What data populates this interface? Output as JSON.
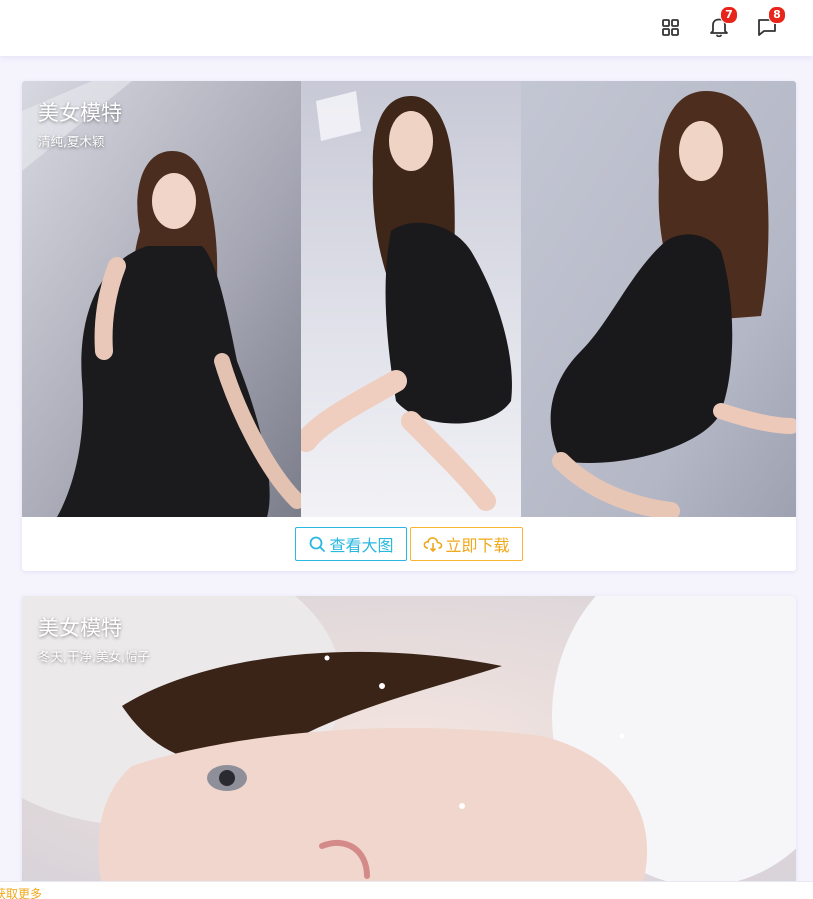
{
  "header": {
    "icons": [
      {
        "name": "grid-apps-icon"
      },
      {
        "name": "bell-icon",
        "badge": "7"
      },
      {
        "name": "message-icon",
        "badge": "8"
      }
    ],
    "badge_color": "#e8251a"
  },
  "cards": [
    {
      "title": "美女模特",
      "tags": "清纯,夏木颖",
      "actions": {
        "view_label": "查看大图",
        "download_label": "立即下载"
      }
    },
    {
      "title": "美女模特",
      "tags": "冬天,干净,美女,帽子"
    }
  ],
  "footer": {
    "text": "获取更多"
  },
  "colors": {
    "view_button": "#2bb8e0",
    "download_button": "#f7b733",
    "page_background": "#f5f4fd"
  }
}
